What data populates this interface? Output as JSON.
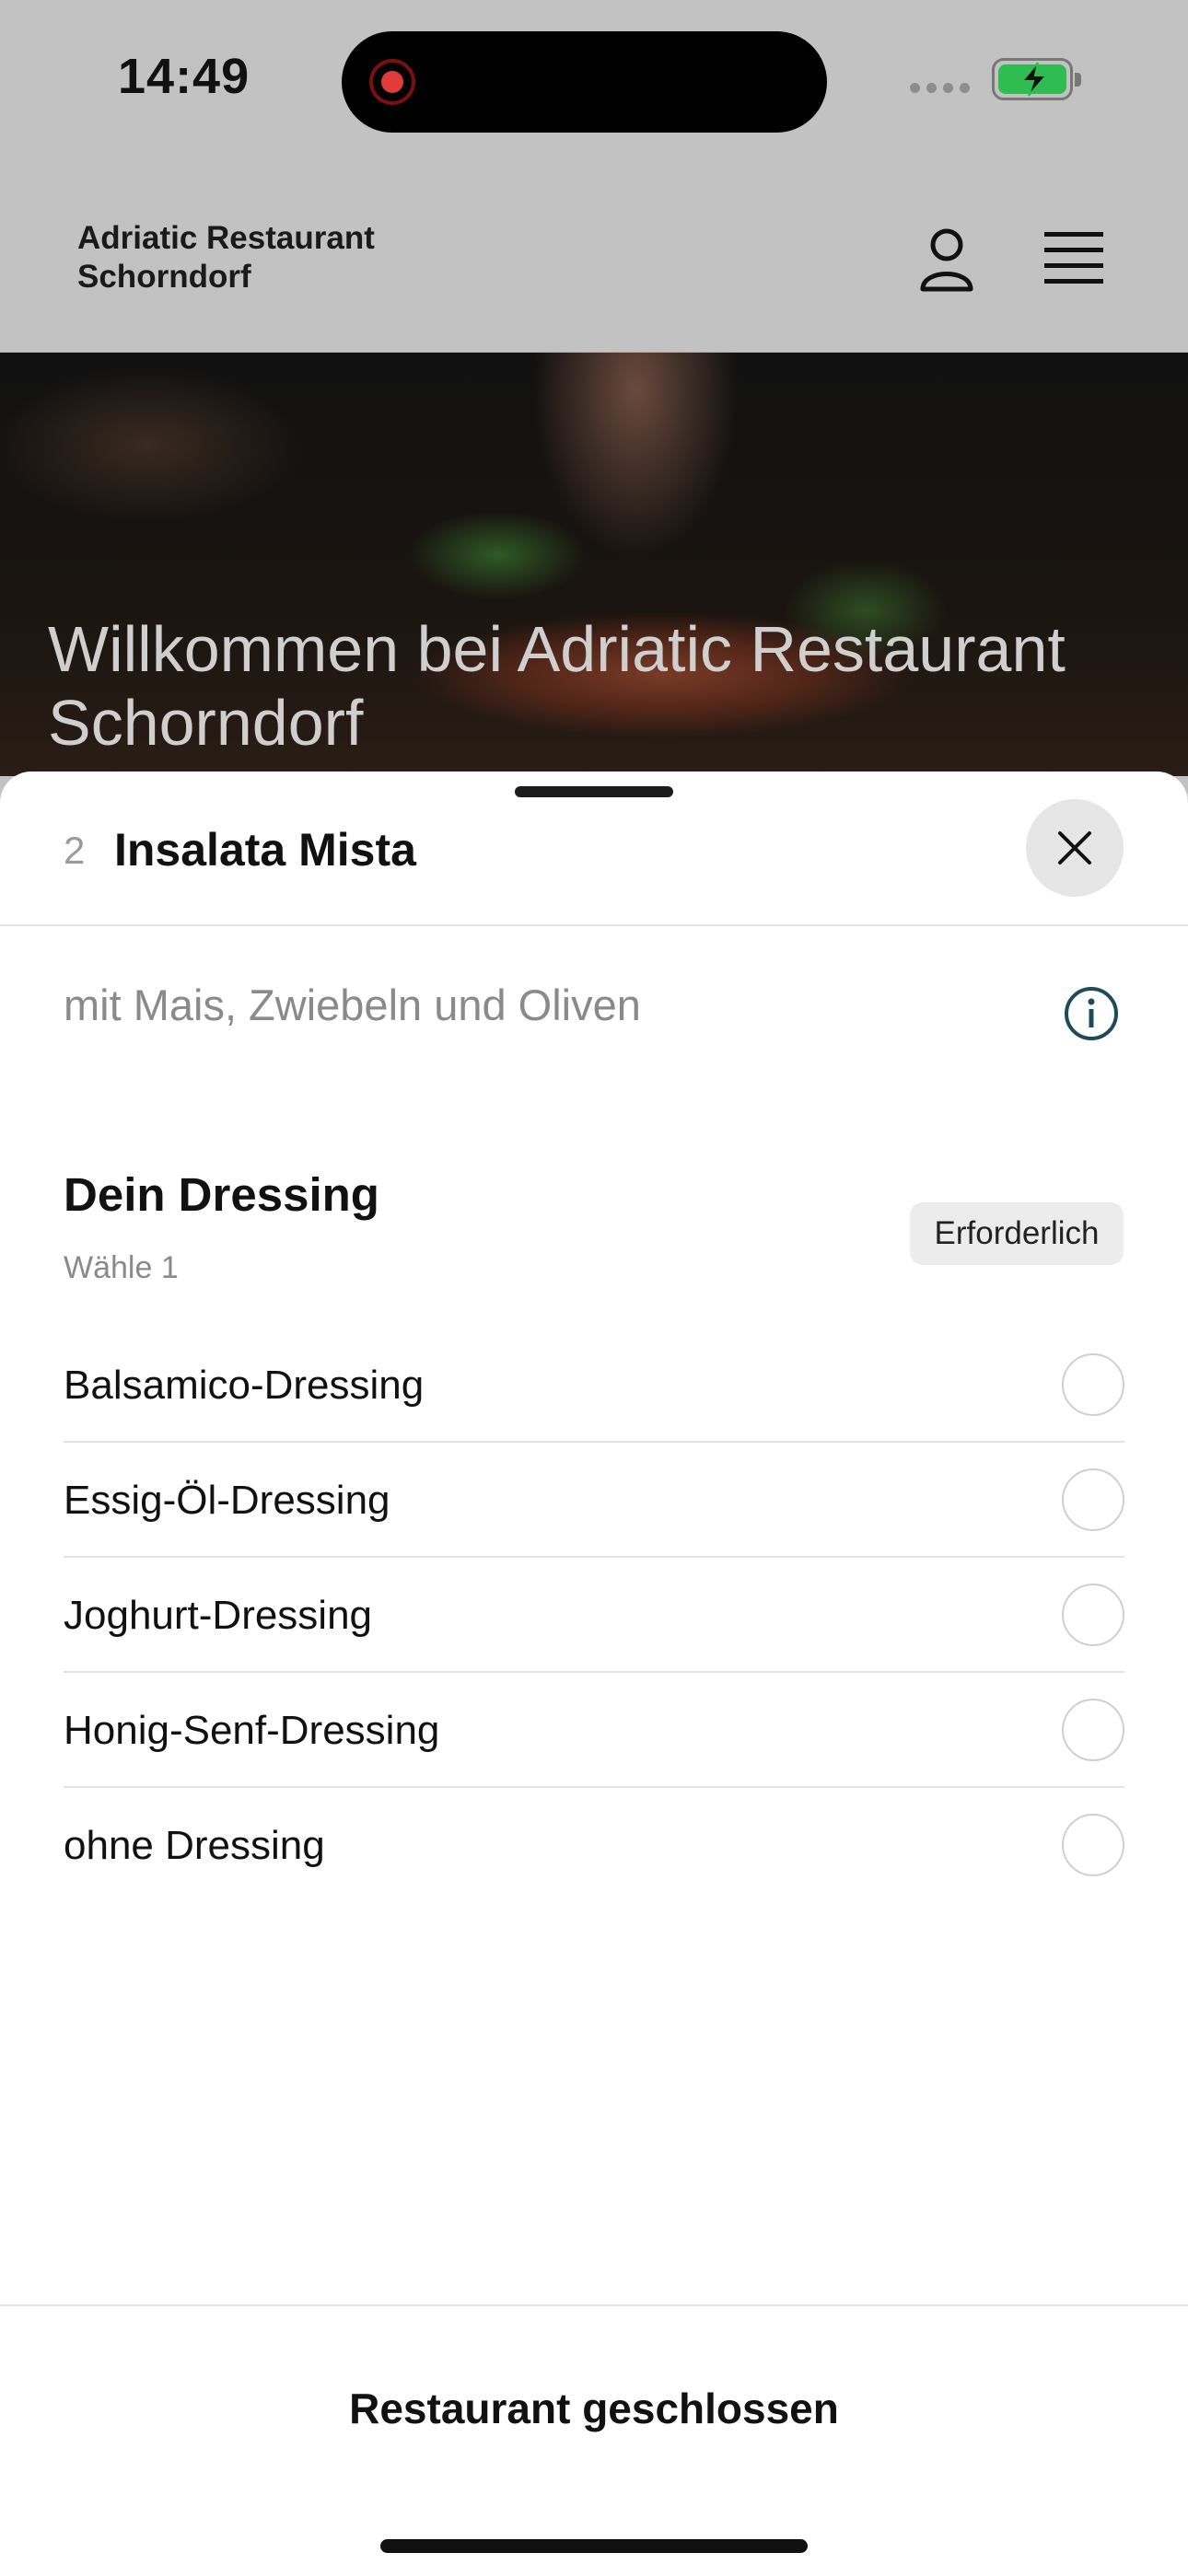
{
  "status_bar": {
    "time": "14:49"
  },
  "header": {
    "brand": "Adriatic Restaurant Schorndorf"
  },
  "hero": {
    "title": "Willkommen bei Adriatic Restaurant Schorndorf"
  },
  "sheet": {
    "item_number": "2",
    "item_title": "Insalata Mista",
    "description": "mit Mais, Zwiebeln und Oliven",
    "option_group": {
      "title": "Dein Dressing",
      "subtitle": "Wähle 1",
      "badge": "Erforderlich",
      "options": [
        {
          "label": "Balsamico-Dressing",
          "selected": false
        },
        {
          "label": "Essig-Öl-Dressing",
          "selected": false
        },
        {
          "label": "Joghurt-Dressing",
          "selected": false
        },
        {
          "label": "Honig-Senf-Dressing",
          "selected": false
        },
        {
          "label": "ohne Dressing",
          "selected": false
        }
      ]
    },
    "footer_label": "Restaurant geschlossen"
  },
  "colors": {
    "battery": "#2fbd52",
    "record_dot": "#e23b3b",
    "info_icon": "#1f4a5a"
  }
}
